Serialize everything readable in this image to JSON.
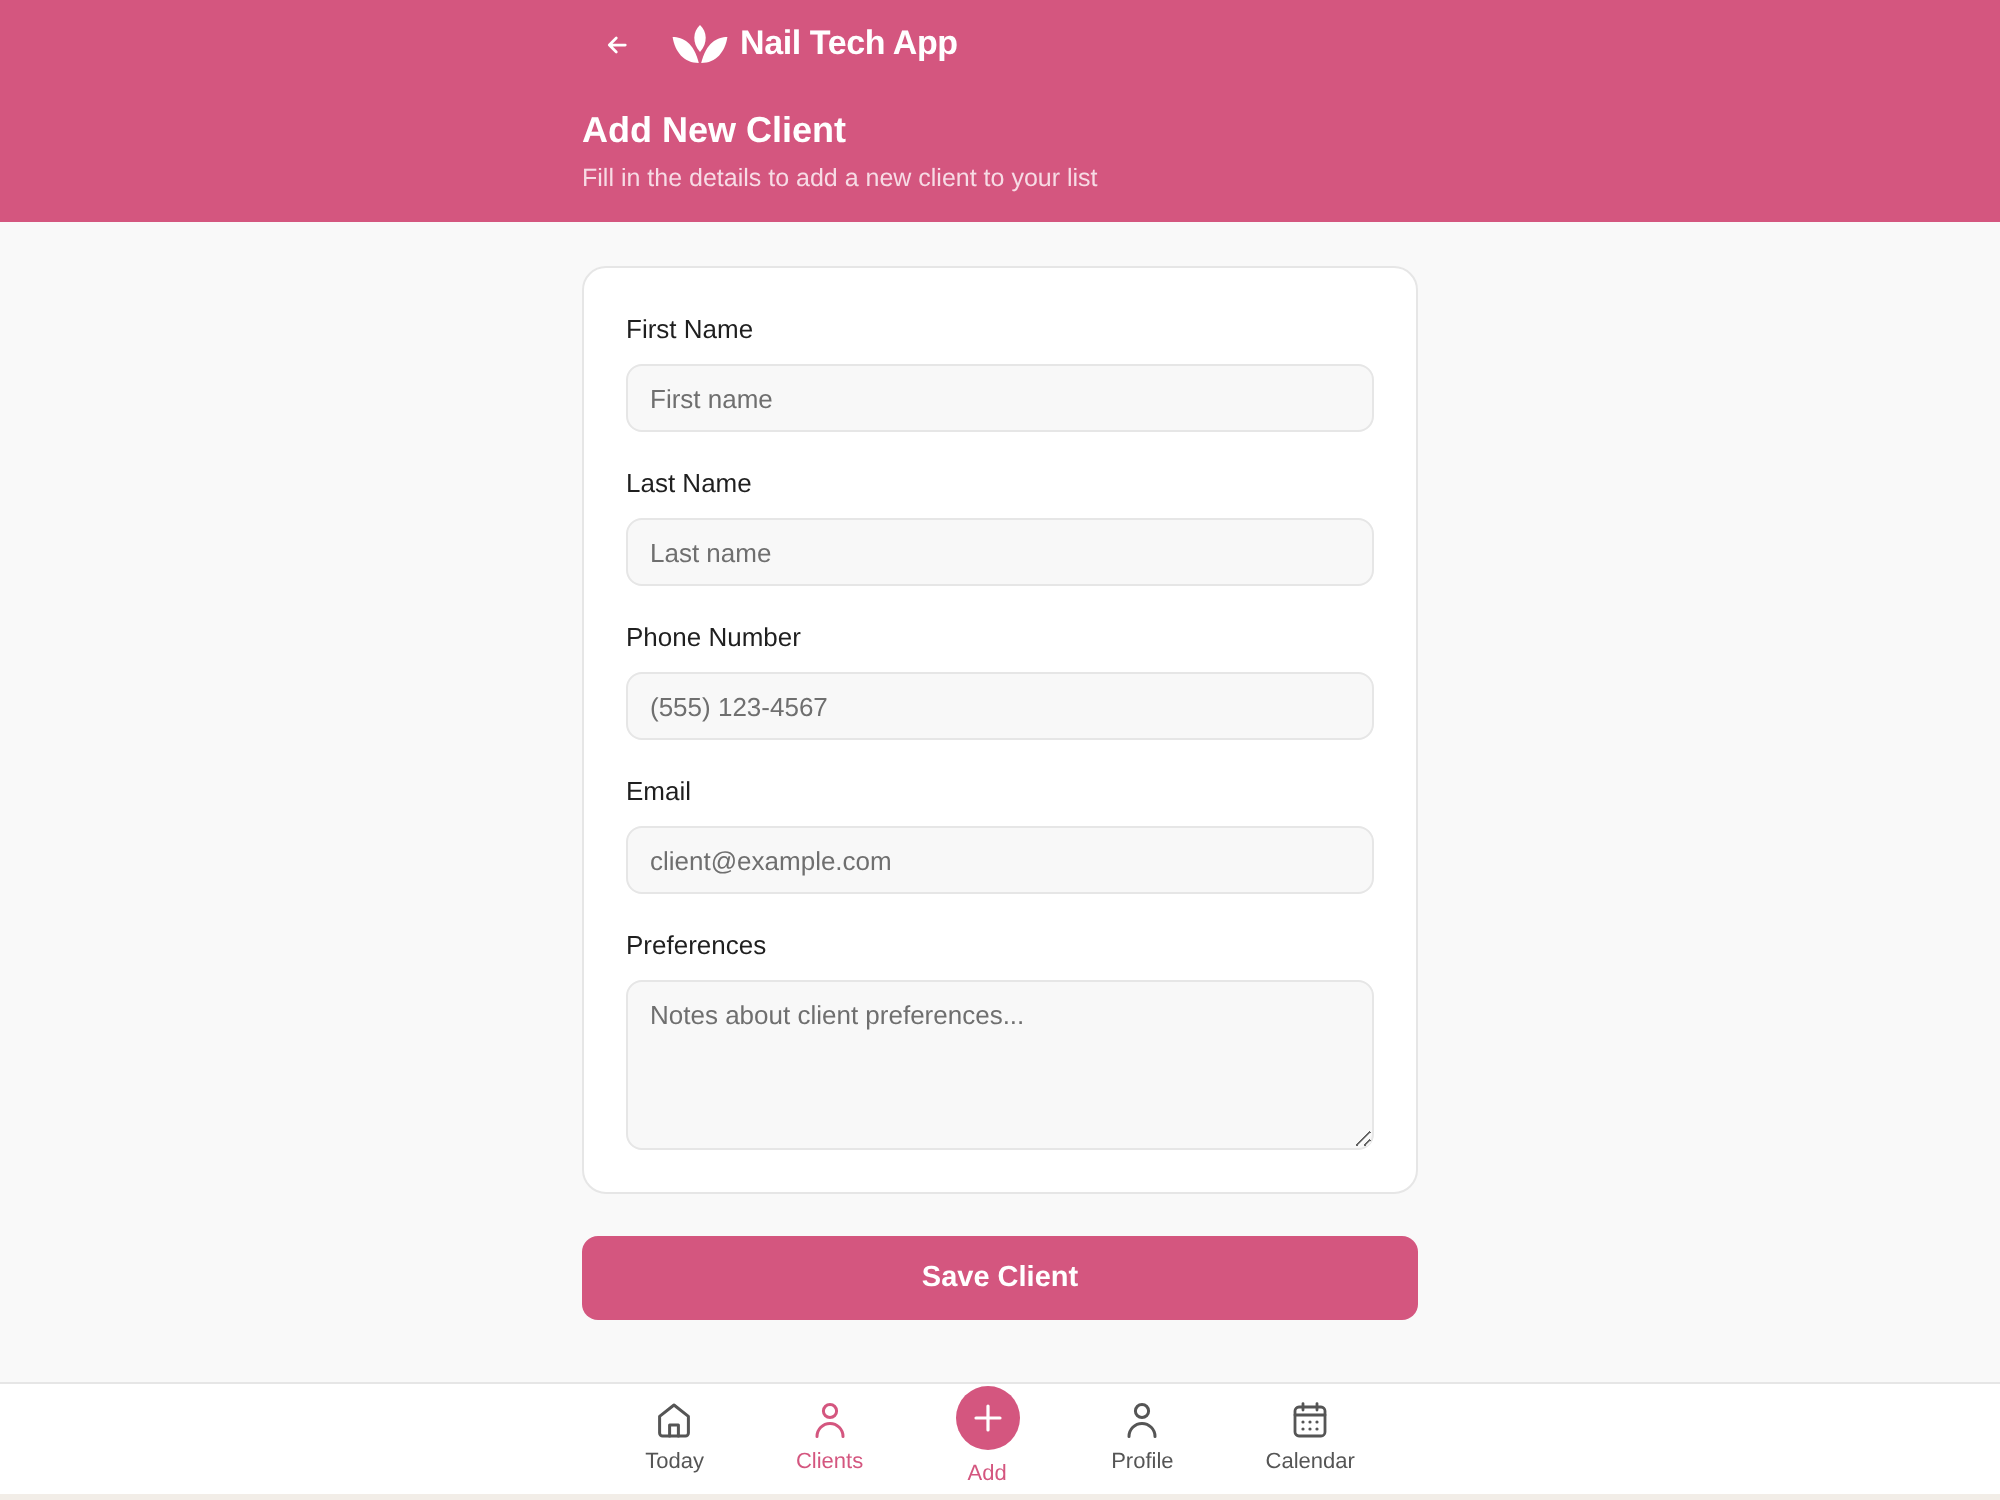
{
  "header": {
    "app_name": "Nail Tech App",
    "title": "Add New Client",
    "subtitle": "Fill in the details to add a new client to your list"
  },
  "form": {
    "fields": [
      {
        "label": "First Name",
        "placeholder": "First name",
        "kind": "text"
      },
      {
        "label": "Last Name",
        "placeholder": "Last name",
        "kind": "text"
      },
      {
        "label": "Phone Number",
        "placeholder": "(555) 123-4567",
        "kind": "text"
      },
      {
        "label": "Email",
        "placeholder": "client@example.com",
        "kind": "text"
      },
      {
        "label": "Preferences",
        "placeholder": "Notes about client preferences...",
        "kind": "multiline"
      }
    ]
  },
  "save_button": {
    "label": "Save Client"
  },
  "bottom_nav": [
    {
      "label": "Today",
      "kind": "tab",
      "selected": false
    },
    {
      "label": "Clients",
      "kind": "tab",
      "selected": true
    },
    {
      "label": "Add",
      "kind": "action",
      "selected": false
    },
    {
      "label": "Profile",
      "kind": "tab",
      "selected": false
    },
    {
      "label": "Calendar",
      "kind": "tab",
      "selected": false
    }
  ]
}
